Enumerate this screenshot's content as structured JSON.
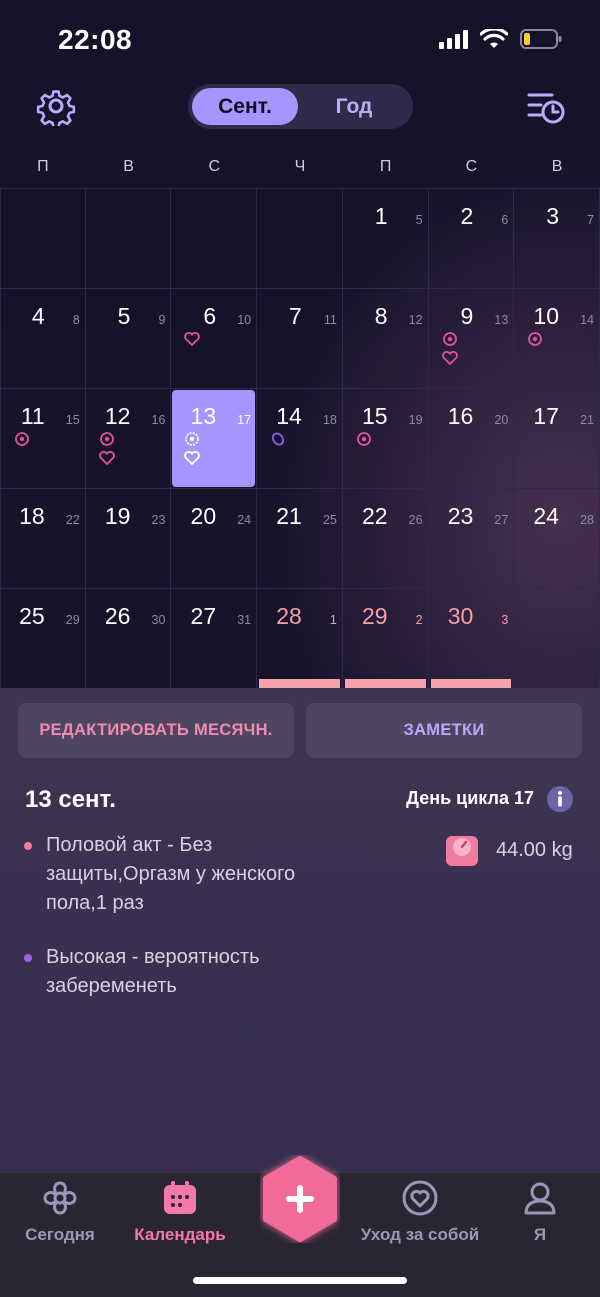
{
  "status_bar": {
    "time": "22:08"
  },
  "header": {
    "view_toggle": {
      "active": "Сент.",
      "inactive": "Год"
    },
    "icons": {
      "settings": "gear-icon",
      "history": "list-clock-icon"
    }
  },
  "calendar": {
    "weekdays": [
      "П",
      "В",
      "С",
      "Ч",
      "П",
      "С",
      "В"
    ],
    "weeks": [
      [
        {
          "day": "",
          "cycle": ""
        },
        {
          "day": "",
          "cycle": ""
        },
        {
          "day": "",
          "cycle": ""
        },
        {
          "day": "",
          "cycle": ""
        },
        {
          "day": "1",
          "cycle": "5"
        },
        {
          "day": "2",
          "cycle": "6"
        },
        {
          "day": "3",
          "cycle": "7"
        }
      ],
      [
        {
          "day": "4",
          "cycle": "8"
        },
        {
          "day": "5",
          "cycle": "9"
        },
        {
          "day": "6",
          "cycle": "10",
          "icons": [
            "heart"
          ]
        },
        {
          "day": "7",
          "cycle": "11"
        },
        {
          "day": "8",
          "cycle": "12"
        },
        {
          "day": "9",
          "cycle": "13",
          "icons": [
            "ovulation",
            "heart"
          ]
        },
        {
          "day": "10",
          "cycle": "14",
          "icons": [
            "ovulation"
          ]
        }
      ],
      [
        {
          "day": "11",
          "cycle": "15",
          "icons": [
            "ovulation"
          ]
        },
        {
          "day": "12",
          "cycle": "16",
          "icons": [
            "ovulation",
            "heart"
          ]
        },
        {
          "day": "13",
          "cycle": "17",
          "selected": true,
          "icons": [
            "ovulation",
            "heart"
          ]
        },
        {
          "day": "14",
          "cycle": "18",
          "icons": [
            "egg"
          ]
        },
        {
          "day": "15",
          "cycle": "19",
          "icons": [
            "ovulation"
          ]
        },
        {
          "day": "16",
          "cycle": "20"
        },
        {
          "day": "17",
          "cycle": "21"
        }
      ],
      [
        {
          "day": "18",
          "cycle": "22"
        },
        {
          "day": "19",
          "cycle": "23"
        },
        {
          "day": "20",
          "cycle": "24"
        },
        {
          "day": "21",
          "cycle": "25"
        },
        {
          "day": "22",
          "cycle": "26"
        },
        {
          "day": "23",
          "cycle": "27"
        },
        {
          "day": "24",
          "cycle": "28"
        }
      ],
      [
        {
          "day": "25",
          "cycle": "29"
        },
        {
          "day": "26",
          "cycle": "30"
        },
        {
          "day": "27",
          "cycle": "31"
        },
        {
          "day": "28",
          "cycle": "1",
          "period": true
        },
        {
          "day": "29",
          "cycle": "2",
          "period": true
        },
        {
          "day": "30",
          "cycle": "3",
          "period": true
        },
        {
          "day": "",
          "cycle": ""
        }
      ]
    ]
  },
  "actions": {
    "edit_period": "РЕДАКТИРОВАТЬ МЕСЯЧН.",
    "notes": "ЗАМЕТКИ"
  },
  "day_details": {
    "date": "13 сент.",
    "cycle_day": "День цикла 17",
    "notes": [
      {
        "text": "Половой акт - Без защиты,Оргазм у женского пола,1 раз",
        "color": "#f07aa0"
      },
      {
        "text": "Высокая - вероятность забеременеть",
        "color": "#a064e0"
      }
    ],
    "weight": "44.00 kg"
  },
  "tabbar": {
    "tabs": [
      {
        "label": "Сегодня",
        "icon": "flower-icon",
        "active": false
      },
      {
        "label": "Календарь",
        "icon": "calendar-icon",
        "active": true
      },
      {
        "label": "Уход за собой",
        "icon": "selfcare-heart-icon",
        "active": false
      },
      {
        "label": "Я",
        "icon": "profile-icon",
        "active": false
      }
    ],
    "add_icon": "plus-icon"
  },
  "colors": {
    "accent": "#a596ff",
    "pink": "#f37aa7",
    "period": "#f3a3a9",
    "background": "#16132a"
  }
}
